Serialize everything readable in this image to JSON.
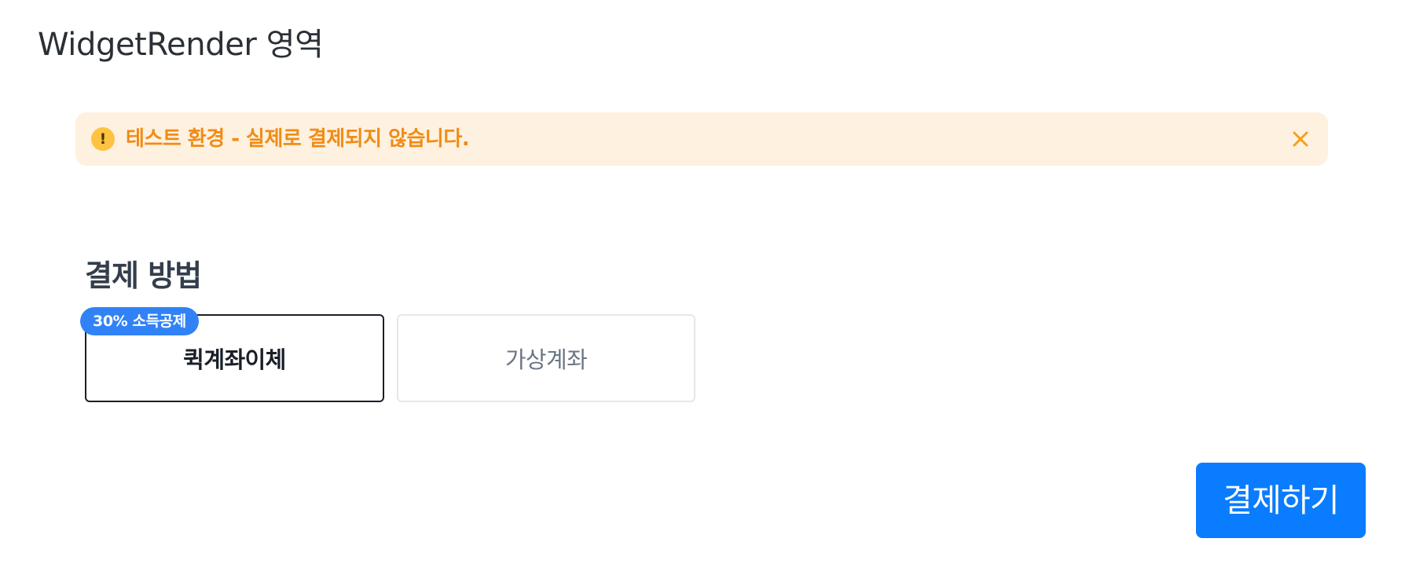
{
  "page": {
    "title": "WidgetRender 영역"
  },
  "alert": {
    "icon": "exclamation-icon",
    "icon_glyph": "!",
    "message": "테스트 환경 - 실제로 결제되지 않습니다.",
    "close_icon": "close-icon",
    "colors": {
      "background": "#fff1df",
      "text": "#f08c17",
      "icon": "#ffc342"
    }
  },
  "payment_methods": {
    "title": "결제 방법",
    "badge": "30% 소득공제",
    "options": [
      {
        "label": "퀵계좌이체",
        "selected": true
      },
      {
        "label": "가상계좌",
        "selected": false
      }
    ],
    "colors": {
      "badge": "#3182f6",
      "selected_border": "#191f28",
      "unselected_border": "#e5e8eb"
    }
  },
  "actions": {
    "pay_label": "결제하기",
    "pay_color": "#0a7cff"
  }
}
